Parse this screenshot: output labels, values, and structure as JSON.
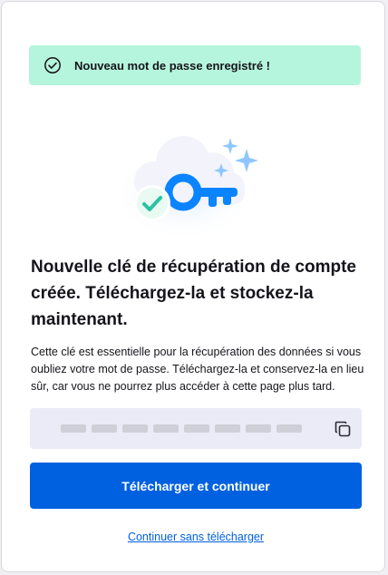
{
  "banner": {
    "icon": "check-circle-icon",
    "text": "Nouveau mot de passe enregistré !",
    "bg_color": "#b6f5dd"
  },
  "illustration": {
    "icon": "recovery-key-illustration"
  },
  "heading": "Nouvelle clé de récupération de compte créée. Téléchargez-la et stockez-la maintenant.",
  "description": "Cette clé est essentielle pour la récupération des données si vous oubliez votre mot de passe. Téléchargez-la et conservez-la en lieu sûr, car vous ne pourrez plus accéder à cette page plus tard.",
  "key_field": {
    "masked_groups": 8,
    "copy_icon": "copy-icon"
  },
  "primary_button": {
    "label": "Télécharger et continuer",
    "color": "#0061e0"
  },
  "secondary_link": {
    "label": "Continuer sans télécharger"
  }
}
